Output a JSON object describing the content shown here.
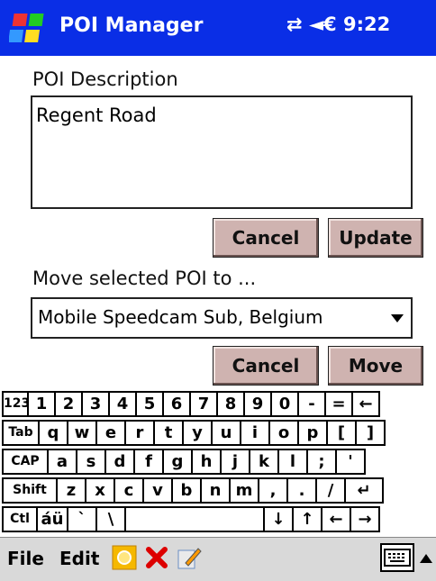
{
  "titlebar": {
    "title": "POI Manager",
    "status": "⇄ ◄€ 9:22"
  },
  "form": {
    "description_label": "POI Description",
    "description_value": "Regent Road",
    "cancel1": "Cancel",
    "update": "Update",
    "move_label": "Move selected POI to ...",
    "select_value": "Mobile Speedcam Sub, Belgium",
    "cancel2": "Cancel",
    "move": "Move"
  },
  "keyboard": {
    "row1": [
      "123",
      "1",
      "2",
      "3",
      "4",
      "5",
      "6",
      "7",
      "8",
      "9",
      "0",
      "-",
      "=",
      "←"
    ],
    "row2": [
      "Tab",
      "q",
      "w",
      "e",
      "r",
      "t",
      "y",
      "u",
      "i",
      "o",
      "p",
      "[",
      "]"
    ],
    "row3": [
      "CAP",
      "a",
      "s",
      "d",
      "f",
      "g",
      "h",
      "j",
      "k",
      "l",
      ";",
      "'"
    ],
    "row4": [
      "Shift",
      "z",
      "x",
      "c",
      "v",
      "b",
      "n",
      "m",
      ",",
      ".",
      "/",
      "↵"
    ],
    "row5": [
      "Ctl",
      "áü",
      "`",
      "\\",
      " ",
      "↓",
      "↑",
      "←",
      "→"
    ]
  },
  "menubar": {
    "file": "File",
    "edit": "Edit"
  }
}
